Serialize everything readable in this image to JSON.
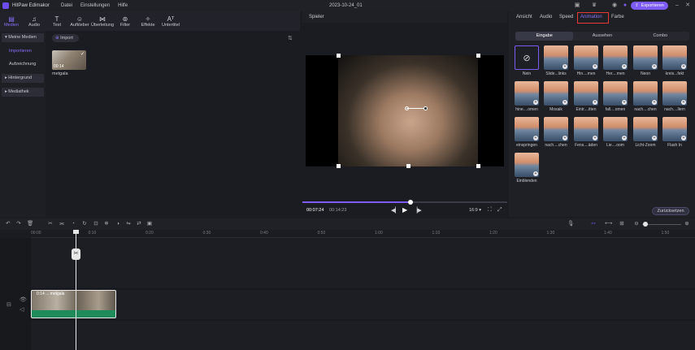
{
  "app": {
    "name": "HitPaw Edimakor",
    "doc_title": "2023-10-24_01",
    "export_label": "Exportieren"
  },
  "menu": [
    "Datei",
    "Einstellungen",
    "Hilfe"
  ],
  "toolbar": [
    {
      "label": "Medien",
      "icon": "media-icon",
      "active": true
    },
    {
      "label": "Audio",
      "icon": "music-icon"
    },
    {
      "label": "Text",
      "icon": "text-icon"
    },
    {
      "label": "Aufkleber",
      "icon": "sticker-icon"
    },
    {
      "label": "Überleitung",
      "icon": "transition-icon"
    },
    {
      "label": "Filter",
      "icon": "filter-icon"
    },
    {
      "label": "Effekte",
      "icon": "effects-icon"
    },
    {
      "label": "Untertitel",
      "icon": "subtitle-icon"
    }
  ],
  "sidebar": {
    "my_media": "Meine Medien",
    "import": "Importieren",
    "recording": "Aufzeichnung",
    "background": "Hintergrund",
    "library": "Mediathek"
  },
  "media": {
    "import_label": "Import",
    "clip": {
      "duration": "00:14",
      "name": "metgala"
    }
  },
  "player": {
    "title": "Spieler",
    "current_time": "00:07:24",
    "total_time": "00:14:23",
    "aspect": "16:9",
    "progress": 0.52
  },
  "right_panel": {
    "tabs": [
      "Ansicht",
      "Audio",
      "Speed",
      "Animation",
      "Farbe"
    ],
    "active_tab": "Animation",
    "segments": [
      "Eingabe",
      "Aussehen",
      "Combo"
    ],
    "active_segment": "Eingabe",
    "animations": [
      "Nein",
      "Slide...links",
      "Hin....men",
      "Her....men",
      "Neon",
      "kreis...fekt",
      "hine....omen",
      "Mosaik",
      "Eintr....itten",
      "fall....omen",
      "nach....chen",
      "nach....llern",
      "einspringen",
      "nach....chen",
      "Fens....äden",
      "Lie....oom",
      "Licht-Zoom",
      "Flash In",
      "Einblenden"
    ],
    "reset_label": "Zurücksetzen"
  },
  "timeline": {
    "ticks": [
      "00:00",
      "0:10",
      "0:20",
      "0:30",
      "0:40",
      "0:50",
      "1:00",
      "1:10",
      "1:20",
      "1:30",
      "1:40",
      "1:50"
    ],
    "clip_label": "0:14 ... metgala"
  }
}
